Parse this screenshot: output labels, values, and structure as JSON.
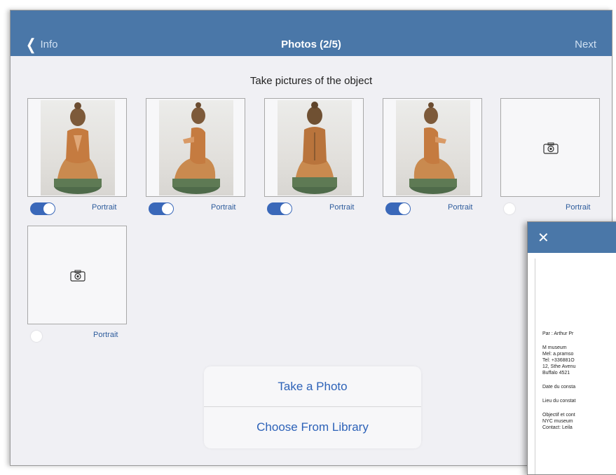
{
  "navbar": {
    "back_label": "Info",
    "title": "Photos (2/5)",
    "next_label": "Next"
  },
  "instructions": "Take pictures of the object",
  "tiles": [
    {
      "has_photo": true,
      "toggle_on": true,
      "portrait_label": "Portrait"
    },
    {
      "has_photo": true,
      "toggle_on": true,
      "portrait_label": "Portrait"
    },
    {
      "has_photo": true,
      "toggle_on": true,
      "portrait_label": "Portrait"
    },
    {
      "has_photo": true,
      "toggle_on": true,
      "portrait_label": "Portrait"
    },
    {
      "has_photo": false,
      "toggle_on": false,
      "portrait_label": "Portrait"
    },
    {
      "has_photo": false,
      "toggle_on": false,
      "portrait_label": "Portrait"
    }
  ],
  "action_sheet": {
    "take_photo_label": "Take a Photo",
    "library_label": "Choose From Library"
  },
  "document_preview": {
    "close_icon": "close-icon",
    "lines": [
      "Par : Arthur Pr",
      "M museum",
      "Mel: a.pramso",
      "Tel: +336881O",
      "12, Sthe Avenu",
      "Buffalo 4521",
      "Date du consta",
      "Lieu du constat",
      "Objectif et cont",
      "NYC museum",
      "Contact: Leila"
    ]
  },
  "colors": {
    "navbar": "#4a77a8",
    "accent": "#2d62b8",
    "toggle_on": "#3a68b9",
    "background": "#f0f0f4"
  }
}
